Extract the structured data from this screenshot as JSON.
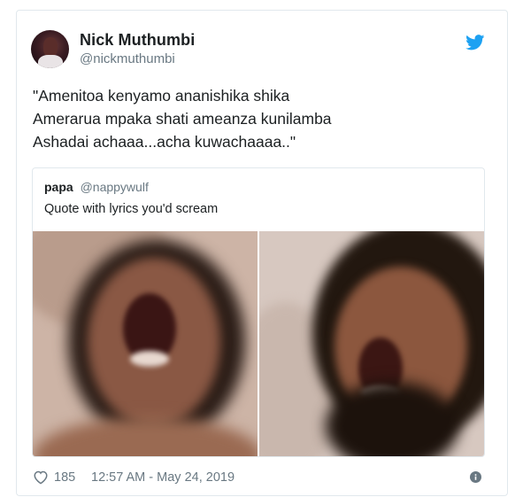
{
  "author": {
    "display_name": "Nick Muthumbi",
    "handle": "@nickmuthumbi",
    "avatar_icon": "profile-photo"
  },
  "brand_icon": "twitter-bird-icon",
  "brand_color": "#1da1f2",
  "tweet": {
    "lines": [
      "\"Amenitoa kenyamo ananishika shika",
      "Amerarua mpaka shati ameanza kunilamba",
      "Ashadai achaaa...acha kuwachaaaa..\""
    ]
  },
  "quoted_tweet": {
    "name": "papa",
    "handle": "@nappywulf",
    "text": "Quote with lyrics you'd scream",
    "media": [
      {
        "description_icon": "photo-person-screaming-left"
      },
      {
        "description_icon": "photo-person-screaming-right"
      }
    ]
  },
  "footer": {
    "like_icon": "heart-icon",
    "like_count": "185",
    "timestamp": "12:57 AM - May 24, 2019",
    "info_icon": "info-icon"
  }
}
